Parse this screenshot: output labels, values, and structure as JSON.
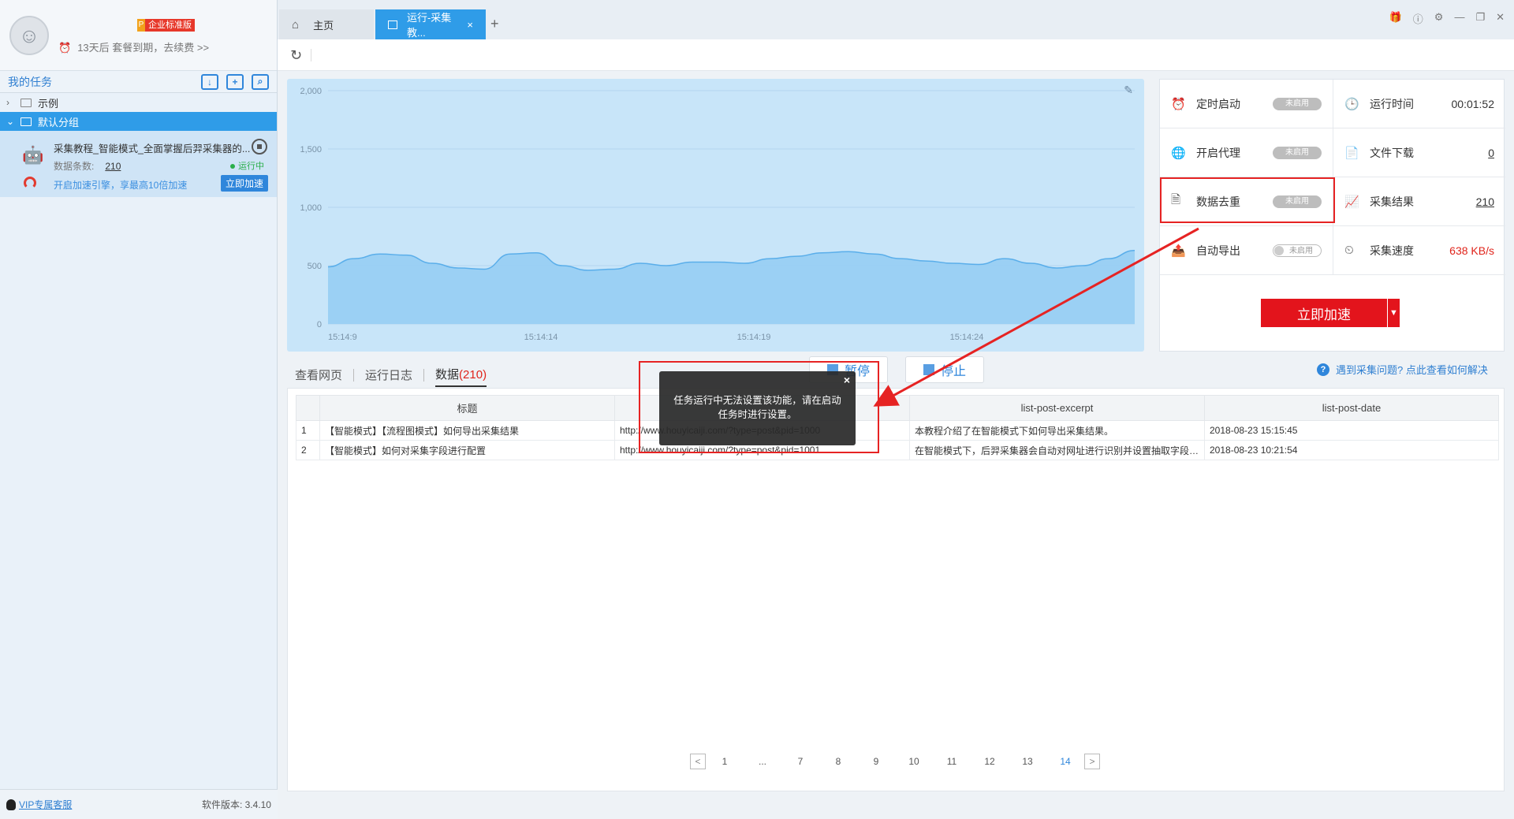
{
  "user": {
    "plan_badge_p": "P",
    "plan_badge": "企业标准版",
    "expire_text": "13天后 套餐到期，去续费 >>"
  },
  "sidebar": {
    "title": "我的任务",
    "groups": [
      {
        "label": "示例",
        "chevron": ">"
      },
      {
        "label": "默认分组",
        "chevron": "v"
      }
    ],
    "task": {
      "name": "采集教程_智能模式_全面掌握后羿采集器的...",
      "count_label": "数据条数:",
      "count_value": "210",
      "status": "运行中",
      "boost_text": "开启加速引擎，享最高10倍加速",
      "boost_button": "立即加速"
    },
    "footer": {
      "vip_link": "VIP专属客服",
      "version": "软件版本: 3.4.10"
    }
  },
  "tabs": {
    "home": "主页",
    "run": "运行-采集教...",
    "run_close": "×",
    "add": "+"
  },
  "chart_data": {
    "type": "area",
    "x_ticks": [
      "15:14:9",
      "15:14:14",
      "15:14:19",
      "15:14:24"
    ],
    "y_ticks": [
      "2,000",
      "1,500",
      "1,000",
      "500",
      "0"
    ],
    "ylim": [
      0,
      2000
    ],
    "series": [
      {
        "values": [
          490,
          560,
          600,
          590,
          520,
          480,
          470,
          600,
          610,
          500,
          460,
          470,
          520,
          500,
          530,
          530,
          520,
          560,
          580,
          610,
          620,
          600,
          560,
          540,
          520,
          510,
          560,
          520,
          480,
          500,
          560,
          630
        ]
      }
    ],
    "fill_color": "#93ccf3",
    "line_color": "#5aaeea"
  },
  "status": {
    "scheduled_label": "定时启动",
    "scheduled_value": "未启用",
    "runtime_label": "运行时间",
    "runtime_value": "00:01:52",
    "proxy_label": "开启代理",
    "proxy_value": "未启用",
    "download_label": "文件下载",
    "download_value": "0",
    "dedupe_label": "数据去重",
    "dedupe_value": "未启用",
    "results_label": "采集结果",
    "results_value": "210",
    "export_label": "自动导出",
    "export_value": "未启用",
    "speed_label": "采集速度",
    "speed_value": "638 KB/s",
    "boost_button": "立即加速"
  },
  "subtabs": {
    "view_page": "查看网页",
    "log": "运行日志",
    "data": "数据",
    "data_count": "(210)"
  },
  "controls": {
    "pause": "暂停",
    "stop": "停止",
    "help": "遇到采集问题? 点此查看如何解决"
  },
  "table": {
    "headers": [
      "",
      "标题",
      "",
      "list-post-excerpt",
      "list-post-date"
    ],
    "rows": [
      [
        "1",
        "【智能模式】【流程图模式】如何导出采集结果",
        "http://www.houyicaiji.com/?type=post&pid=1000",
        "本教程介绍了在智能模式下如何导出采集结果。",
        "2018-08-23 15:15:45"
      ],
      [
        "2",
        "【智能模式】如何对采集字段进行配置",
        "http://www.houyicaiji.com/?type=post&pid=1001",
        "在智能模式下，后羿采集器会自动对网址进行识别并设置抽取字段。...",
        "2018-08-23 10:21:54"
      ]
    ]
  },
  "pager": {
    "prev": "<",
    "pages": [
      "1",
      "...",
      "7",
      "8",
      "9",
      "10",
      "11",
      "12",
      "13",
      "14"
    ],
    "current": "14",
    "next": ">"
  },
  "popup": {
    "message": "任务运行中无法设置该功能，请在启动任务时进行设置。",
    "close": "×"
  }
}
